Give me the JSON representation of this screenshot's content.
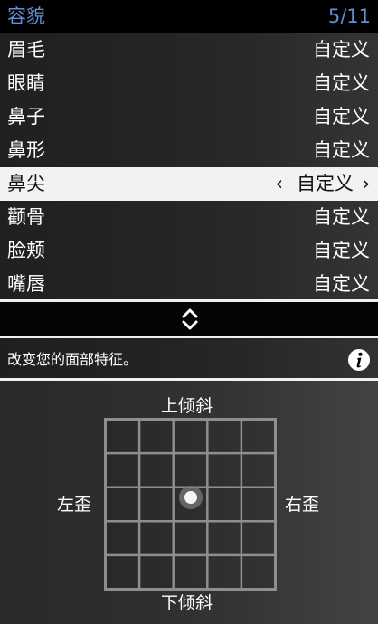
{
  "header": {
    "title": "容貌",
    "count": "5/11"
  },
  "menu": {
    "items": [
      {
        "label": "眉毛",
        "value": "自定义"
      },
      {
        "label": "眼睛",
        "value": "自定义"
      },
      {
        "label": "鼻子",
        "value": "自定义"
      },
      {
        "label": "鼻形",
        "value": "自定义"
      },
      {
        "label": "鼻尖",
        "value": "自定义",
        "selected": true
      },
      {
        "label": "颧骨",
        "value": "自定义"
      },
      {
        "label": "脸颊",
        "value": "自定义"
      },
      {
        "label": "嘴唇",
        "value": "自定义"
      }
    ],
    "arrow_left": "‹",
    "arrow_right": "›"
  },
  "scroll": {
    "icon": "up-down-chevron-icon"
  },
  "description": {
    "text": "改变您的面部特征。",
    "icon": "info-icon"
  },
  "pad": {
    "top_label": "上倾斜",
    "bottom_label": "下倾斜",
    "left_label": "左歪",
    "right_label": "右歪",
    "grid_divisions": 5,
    "knob_x": 0.5,
    "knob_y": 0.46
  },
  "colors": {
    "header_text": "#5f8fd4",
    "selected_bg": "#f2f2f2",
    "grid_line": "#8a8a8a"
  }
}
